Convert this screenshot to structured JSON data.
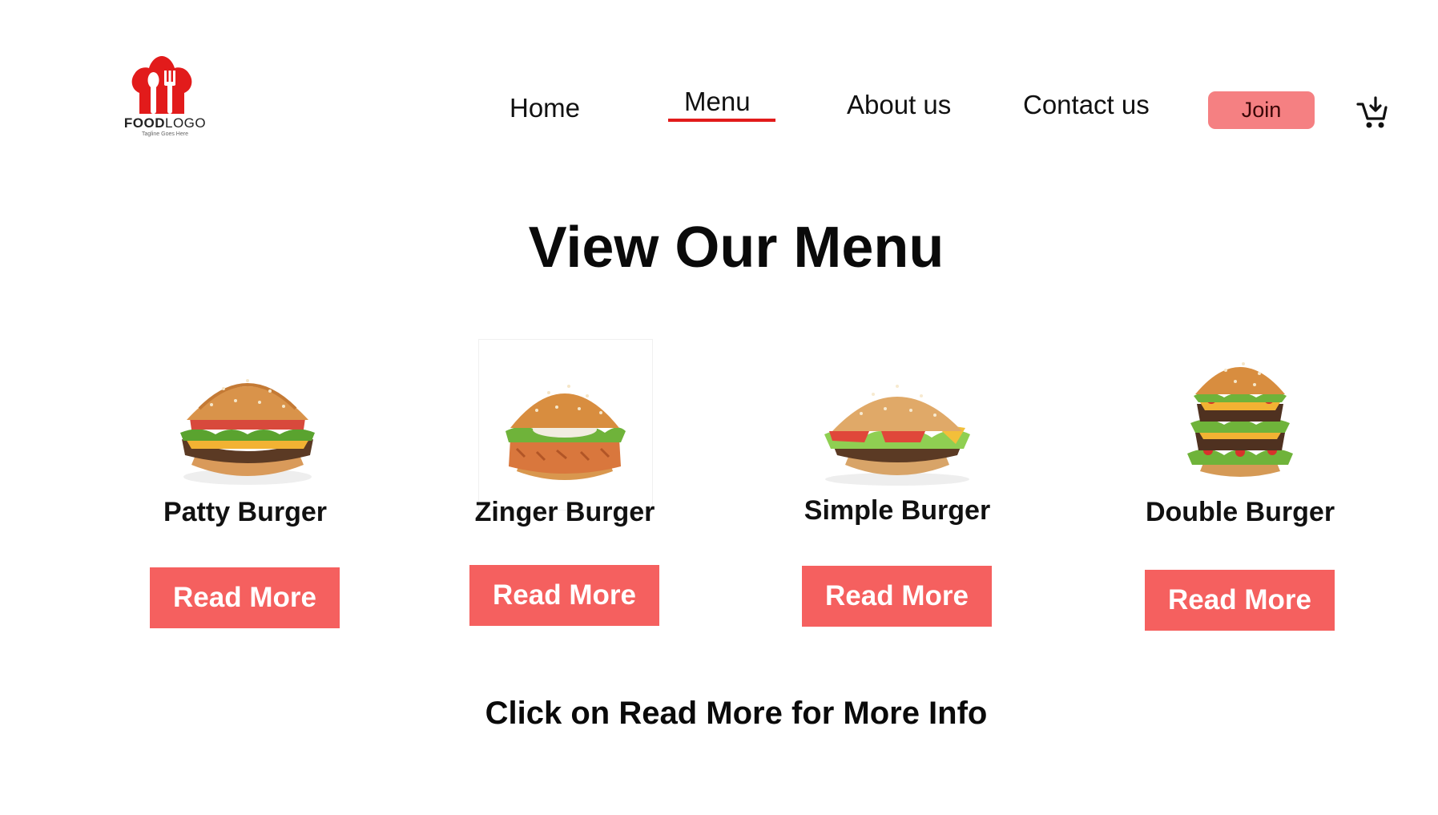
{
  "logo": {
    "word_bold": "FOOD",
    "word_light": "LOGO",
    "tagline": "Tagline Goes Here"
  },
  "nav": {
    "home": "Home",
    "menu": "Menu",
    "about": "About us",
    "contact": "Contact us",
    "join": "Join",
    "active": "Menu",
    "cart_icon": "cart-icon"
  },
  "headline": "View Our Menu",
  "items": [
    {
      "name": "Patty Burger",
      "button": "Read More"
    },
    {
      "name": "Zinger Burger",
      "button": "Read More"
    },
    {
      "name": "Simple Burger",
      "button": "Read More"
    },
    {
      "name": "Double Burger",
      "button": "Read More"
    }
  ],
  "footer_note": "Click on Read More for More Info",
  "colors": {
    "accent": "#f5605f",
    "join_bg": "#f58082",
    "underline": "#e21b1b",
    "logo_red": "#e21b1b"
  }
}
